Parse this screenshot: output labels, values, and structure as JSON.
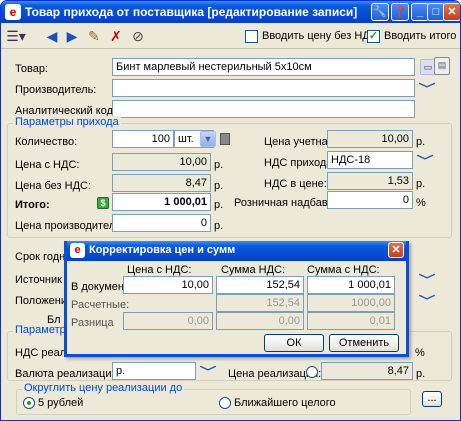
{
  "window": {
    "title": "Товар прихода от поставщика [редактирование записи]",
    "buttons": {
      "tools": "🔧",
      "help": "❓",
      "minimize": "_",
      "maximize": "□",
      "close": "✕"
    }
  },
  "toolbar": {
    "check_no_vat": {
      "label": "Вводить цену без НДС",
      "checked": false
    },
    "check_total": {
      "label": "Вводить итого",
      "checked": true,
      "mark": "✓"
    }
  },
  "form": {
    "product_label": "Товар:",
    "product_value": "Бинт марлевый нестерильный 5х10см",
    "manufacturer_label": "Производитель:",
    "manufacturer_value": "",
    "analytic_label": "Аналитический код:",
    "analytic_value": "",
    "params_group": "Параметры прихода",
    "qty_label": "Количество:",
    "qty_value": "100",
    "unit_value": "шт.",
    "price_acc_label": "Цена учетная:",
    "price_acc_value": "10,00",
    "price_acc_unit": "р.",
    "price_vat_label": "Цена с НДС:",
    "price_vat_value": "10,00",
    "price_vat_unit": "р.",
    "vat_in_label": "НДС прихода:",
    "vat_in_value": "НДС-18",
    "price_novat_label": "Цена без НДС:",
    "price_novat_value": "8,47",
    "price_novat_unit": "р.",
    "vat_price_label": "НДС в цене:",
    "vat_price_value": "1,53",
    "vat_price_unit": "р.",
    "total_label": "Итого:",
    "total_icon": "$",
    "total_value": "1 000,01",
    "total_unit": "р.",
    "markup_label": "Розничная надбавка:",
    "markup_value": "0",
    "markup_unit": "%",
    "mfr_price_label": "Цена производителя:",
    "mfr_price_value": "0",
    "mfr_price_unit": "р.",
    "shelf_label": "Срок годно",
    "source_label": "Источник ф",
    "position_label": "Положение",
    "bl_label": "Бл",
    "params2_group": "Параметр",
    "vat_sale_label": "НДС реали",
    "vat_sale_unit": "%",
    "currency_label": "Валюта реализации:",
    "currency_value": "р.",
    "sale_price_label": "Цена реализации:",
    "sale_price_value": "8,47",
    "sale_price_unit": "р.",
    "round_group": "Округлить цену реализации до",
    "round_opt1": "5 рублей",
    "round_opt2": "Ближайшего целого",
    "round_btn": "..."
  },
  "dialog": {
    "title": "Корректировка цен и сумм",
    "col1": "Цена с НДС:",
    "col2": "Сумма НДС:",
    "col3": "Сумма с НДС:",
    "row_doc": {
      "label": "В документе:",
      "v1": "10,00",
      "v2": "152,54",
      "v3": "1 000,01"
    },
    "row_calc": {
      "label": "Расчетные:",
      "v1": "",
      "v2": "152,54",
      "v3": "1000,00"
    },
    "row_diff": {
      "label": "Разница",
      "v1": "0,00",
      "v2": "0,00",
      "v3": "0,01"
    },
    "ok": "ОК",
    "cancel": "Отменить"
  },
  "colors": {
    "title_blue": "#0549d0",
    "group_title": "#0046d5",
    "close_red": "#c0401f"
  }
}
